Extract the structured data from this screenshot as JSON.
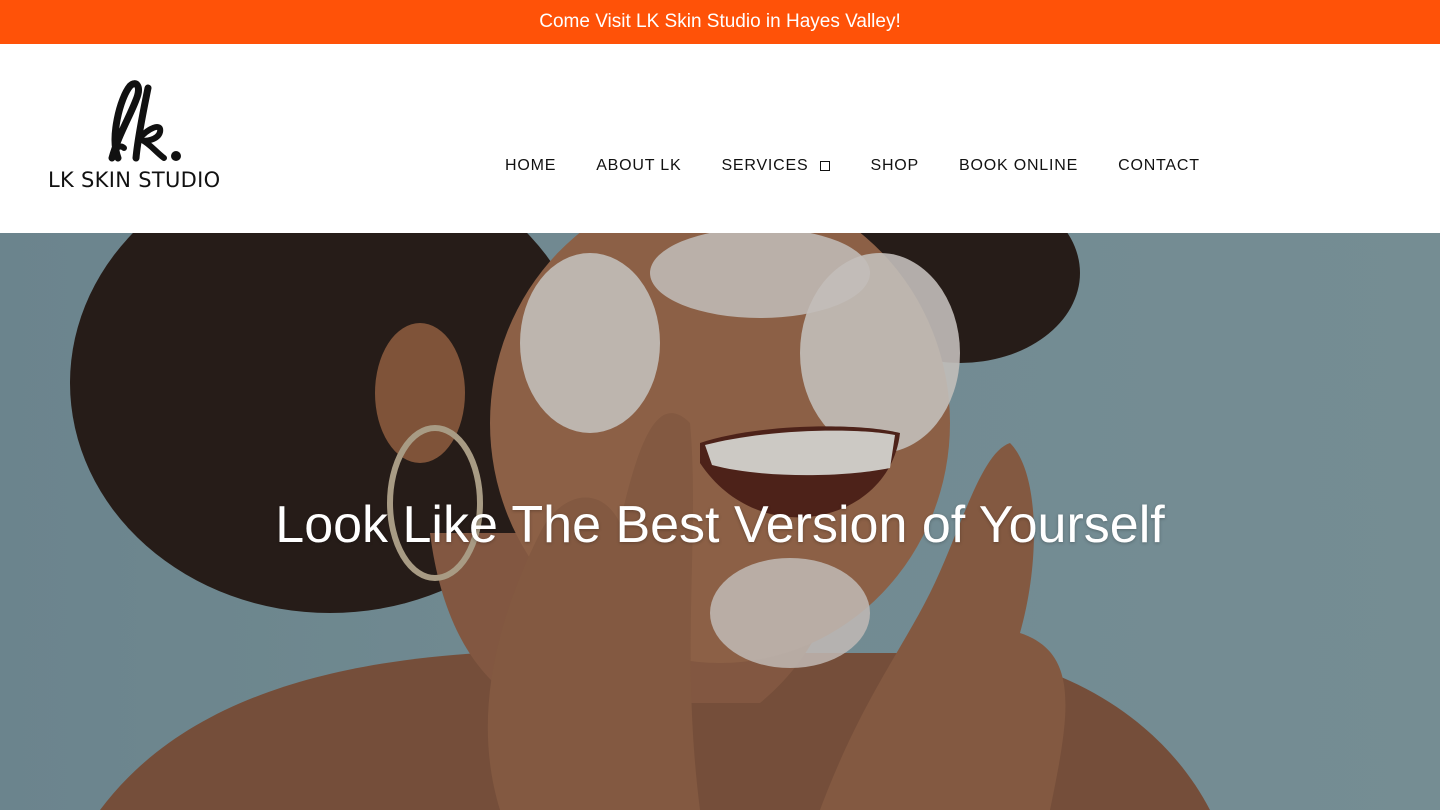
{
  "announcement": {
    "text": "Come Visit LK Skin Studio in Hayes Valley!"
  },
  "logo": {
    "mark": "lk.",
    "name": "LK SKIN STUDIO"
  },
  "nav": {
    "items": [
      {
        "label": "HOME"
      },
      {
        "label": "ABOUT LK"
      },
      {
        "label": "SERVICES",
        "icon": "dropdown-box-icon"
      },
      {
        "label": "SHOP"
      },
      {
        "label": "BOOK ONLINE"
      },
      {
        "label": "CONTACT"
      }
    ]
  },
  "hero": {
    "title": "Look Like The Best Version of Yourself",
    "image": "woman-washing-face-with-foam"
  },
  "colors": {
    "announcement_bg": "#ff5208",
    "text": "#111111",
    "hero_bg": "#86a3ab"
  }
}
